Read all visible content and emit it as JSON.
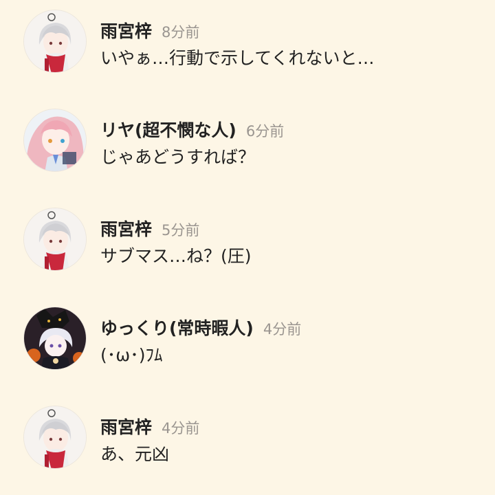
{
  "messages": [
    {
      "name": "雨宮梓",
      "time": "8分前",
      "text": "いやぁ…行動で示してくれないと…",
      "avatar": "white-hair-boy-red-scarf-avatar"
    },
    {
      "name": "リヤ(超不憫な人)",
      "time": "6分前",
      "text": "じゃあどうすれば？",
      "avatar": "pink-hair-girl-avatar"
    },
    {
      "name": "雨宮梓",
      "time": "5分前",
      "text": "サブマス…ね？(圧)",
      "avatar": "white-hair-boy-red-scarf-avatar"
    },
    {
      "name": "ゆっくり(常時暇人)",
      "time": "4分前",
      "text": "(･ω･)ﾌﾑ",
      "avatar": "fox-mask-character-avatar"
    },
    {
      "name": "雨宮梓",
      "time": "4分前",
      "text": "あ、元凶",
      "avatar": "white-hair-boy-red-scarf-avatar"
    }
  ]
}
